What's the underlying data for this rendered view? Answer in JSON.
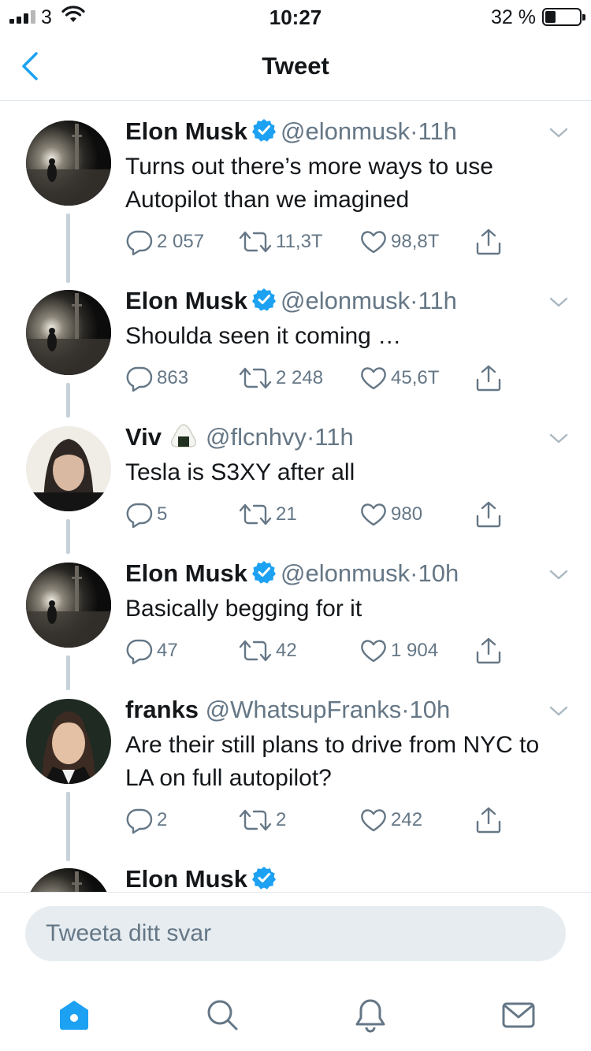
{
  "status_bar": {
    "carrier": "3",
    "time": "10:27",
    "battery_text": "32 %",
    "battery_level": 0.32
  },
  "nav": {
    "title": "Tweet"
  },
  "tweets": [
    {
      "name": "Elon Musk",
      "verified": true,
      "handle": "@elonmusk",
      "dot": "·",
      "time": "11h",
      "text": "Turns out there’s more ways to use Autopilot than we imagined",
      "replies": "2 057",
      "retweets": "11,3T",
      "likes": "98,8T"
    },
    {
      "name": "Elon Musk",
      "verified": true,
      "handle": "@elonmusk",
      "dot": "·",
      "time": "11h",
      "text": "Shoulda seen it coming …",
      "replies": "863",
      "retweets": "2 248",
      "likes": "45,6T"
    },
    {
      "name": "Viv",
      "verified": false,
      "handle": "@flcnhvy",
      "dot": "·",
      "time": "11h",
      "text": "Tesla is S3XY after all",
      "replies": "5",
      "retweets": "21",
      "likes": "980"
    },
    {
      "name": "Elon Musk",
      "verified": true,
      "handle": "@elonmusk",
      "dot": "·",
      "time": "10h",
      "text": "Basically begging for it",
      "replies": "47",
      "retweets": "42",
      "likes": "1 904"
    },
    {
      "name": "franks",
      "verified": false,
      "handle": "@WhatsupFranks",
      "dot": "·",
      "time": "10h",
      "text": "Are their still plans to drive from NYC to LA on full autopilot?",
      "replies": "2",
      "retweets": "2",
      "likes": "242"
    },
    {
      "name": "Elon Musk",
      "verified": true
    }
  ],
  "reply": {
    "placeholder": "Tweeta ditt svar"
  },
  "tab_bar": {
    "items": [
      "home-icon",
      "search-icon",
      "notifications-icon",
      "messages-icon"
    ]
  },
  "colors": {
    "accent": "#1da1f2",
    "secondary_text": "#657786",
    "thread_line": "#c7d2da",
    "reply_field": "#e6ecf0"
  }
}
